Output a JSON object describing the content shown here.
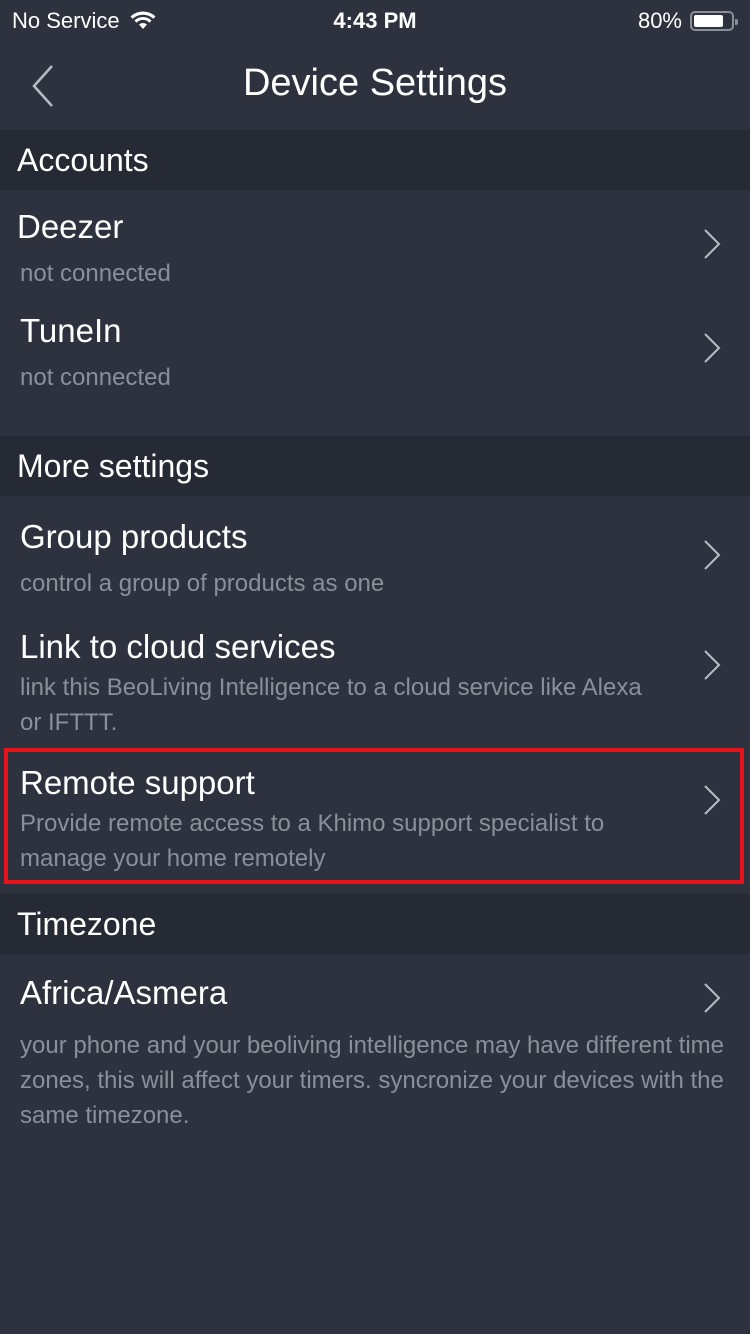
{
  "status_bar": {
    "carrier": "No Service",
    "wifi_icon": "wifi-icon",
    "time": "4:43 PM",
    "battery_percent": "80%",
    "battery_level": 0.8
  },
  "nav": {
    "back_icon": "chevron-left-icon",
    "title": "Device Settings"
  },
  "sections": [
    {
      "header": "Accounts",
      "items": [
        {
          "title": "Deezer",
          "subtitle": "not connected"
        },
        {
          "title": "TuneIn",
          "subtitle": "not connected"
        }
      ]
    },
    {
      "header": "More settings",
      "items": [
        {
          "title": "Group products",
          "subtitle": "control a group of products as one"
        },
        {
          "title": "Link to cloud services",
          "subtitle": "link this BeoLiving Intelligence to a cloud service like Alexa or IFTTT."
        },
        {
          "title": "Remote support",
          "subtitle": "Provide remote access to a Khimo support specialist to manage your home remotely",
          "highlighted": true
        }
      ]
    },
    {
      "header": "Timezone",
      "items": [
        {
          "title": "Africa/Asmera",
          "subtitle": "your phone and your beoliving intelligence may have different time zones, this will affect your timers. syncronize your devices with the same timezone."
        }
      ]
    }
  ],
  "colors": {
    "background": "#2d323e",
    "section_header_bg": "#262a34",
    "subtitle_text": "#8b8f99",
    "highlight_border": "#e8141c"
  }
}
